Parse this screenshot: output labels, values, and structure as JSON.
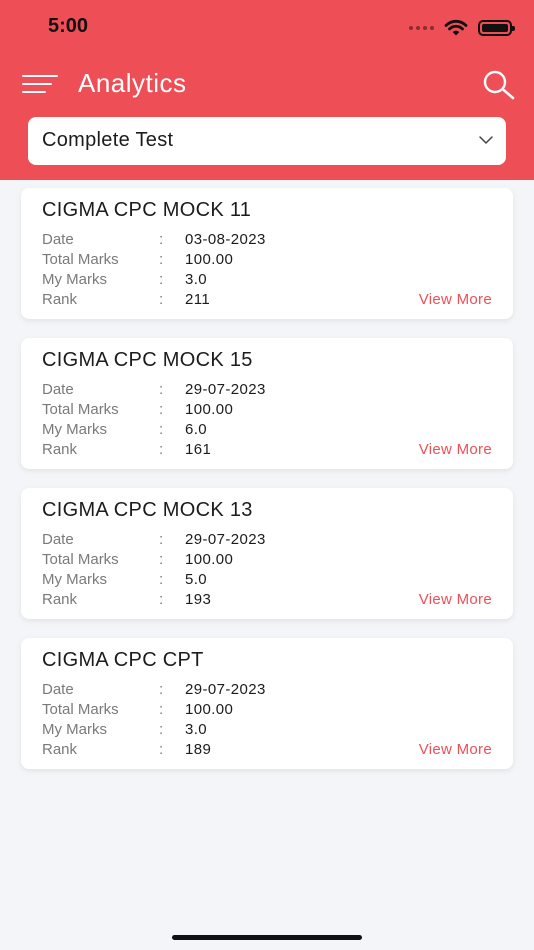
{
  "status_bar": {
    "time": "5:00"
  },
  "header": {
    "title": "Analytics",
    "accent_color": "#ee4f57"
  },
  "filter": {
    "selected": "Complete Test"
  },
  "field_labels": {
    "date": "Date",
    "total_marks": "Total Marks",
    "my_marks": "My Marks",
    "rank": "Rank",
    "separator": ":",
    "view_more": "View More"
  },
  "tests": [
    {
      "name": "CIGMA CPC MOCK 11",
      "date": "03-08-2023",
      "total_marks": "100.00",
      "my_marks": "3.0",
      "rank": "211"
    },
    {
      "name": "CIGMA CPC MOCK 15",
      "date": "29-07-2023",
      "total_marks": "100.00",
      "my_marks": "6.0",
      "rank": "161"
    },
    {
      "name": "CIGMA CPC MOCK 13",
      "date": "29-07-2023",
      "total_marks": "100.00",
      "my_marks": "5.0",
      "rank": "193"
    },
    {
      "name": "CIGMA CPC CPT",
      "date": "29-07-2023",
      "total_marks": "100.00",
      "my_marks": "3.0",
      "rank": "189"
    }
  ]
}
